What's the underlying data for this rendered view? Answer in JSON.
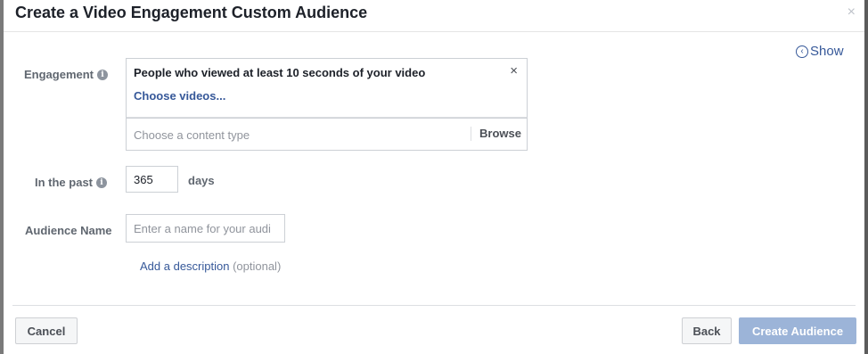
{
  "dialog": {
    "title": "Create a Video Engagement Custom Audience",
    "close_glyph": "×",
    "show_label": "Show"
  },
  "engagement": {
    "label": "Engagement",
    "selected_title": "People who viewed at least 10 seconds of your video",
    "remove_glyph": "×",
    "choose_videos": "Choose videos...",
    "content_type_placeholder": "Choose a content type",
    "browse": "Browse"
  },
  "past": {
    "label": "In the past",
    "value": "365",
    "unit": "days"
  },
  "audience_name": {
    "label": "Audience Name",
    "placeholder": "Enter a name for your audi",
    "value": ""
  },
  "description": {
    "link": "Add a description",
    "optional": "(optional)"
  },
  "footer": {
    "cancel": "Cancel",
    "back": "Back",
    "create": "Create Audience"
  },
  "icons": {
    "info": "info-icon",
    "show": "chevron-left-circle-icon",
    "close": "close-icon"
  },
  "colors": {
    "link": "#365899",
    "primary_disabled": "#9cb4d8",
    "label": "#606770"
  }
}
